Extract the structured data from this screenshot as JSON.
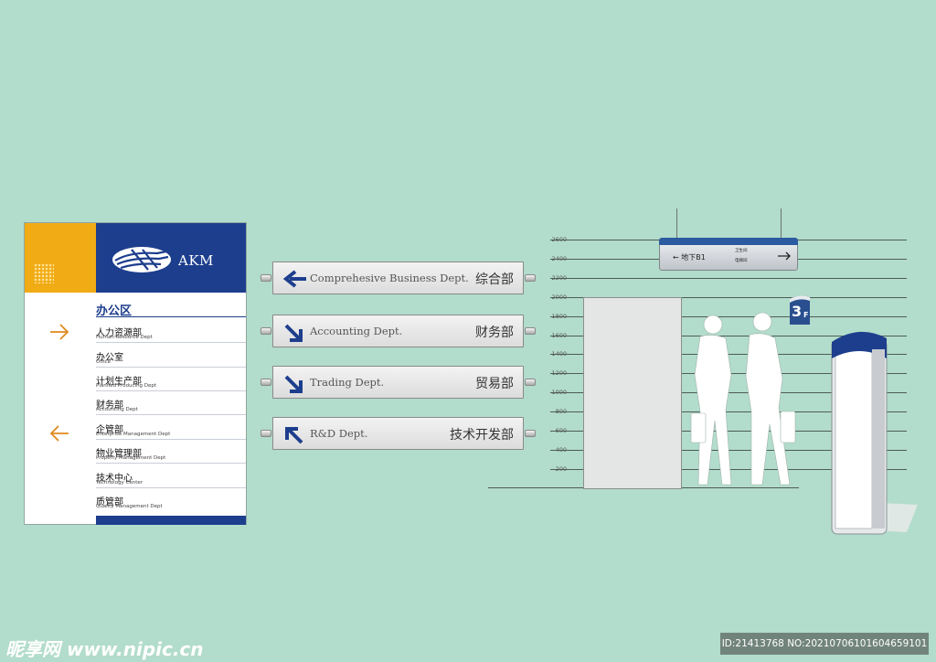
{
  "directory_board": {
    "brand": "AKM",
    "zone_title": "办公区",
    "departments": [
      {
        "cn": "人力资源部",
        "en": "Human Resource Dept"
      },
      {
        "cn": "办公室",
        "en": "Office"
      },
      {
        "cn": "计划生产部",
        "en": "Planned Producing Dept"
      },
      {
        "cn": "财务部",
        "en": "Accounting Dept"
      },
      {
        "cn": "企管部",
        "en": "Enterprise Management Dept"
      },
      {
        "cn": "物业管理部",
        "en": "Property Management Dept"
      },
      {
        "cn": "技术中心",
        "en": "Technology Center"
      },
      {
        "cn": "质管部",
        "en": "Quality Management Dept"
      }
    ],
    "arrows": [
      "arrow-right-icon",
      "arrow-left-icon"
    ]
  },
  "direction_signs": [
    {
      "en": "Comprehesive Business Dept.",
      "cn": "综合部",
      "icon": "arrow-left-icon"
    },
    {
      "en": "Accounting Dept.",
      "cn": "财务部",
      "icon": "arrow-down-right-icon"
    },
    {
      "en": "Trading Dept.",
      "cn": "贸易部",
      "icon": "arrow-down-right-icon"
    },
    {
      "en": "R&D Dept.",
      "cn": "技术开发部",
      "icon": "arrow-up-left-icon"
    }
  ],
  "height_scale": {
    "ticks": [
      "2600",
      "2400",
      "2200",
      "2000",
      "1800",
      "1600",
      "1400",
      "1200",
      "1000",
      "800",
      "600",
      "400",
      "200"
    ]
  },
  "overhead_sign": {
    "main": "← 地下B1",
    "right_top": "卫生间",
    "right_bottom": "电梯间"
  },
  "floor_sign": {
    "number": "3",
    "suffix": "F"
  },
  "watermark": {
    "left": "昵享网 www.nipic.cn",
    "right": "ID:21413768 NO:20210706101604659101"
  },
  "colors": {
    "navy": "#1d3e8d",
    "yellow": "#f1ab14",
    "orange_arrow": "#e08a1e",
    "background": "#b2dccb"
  }
}
